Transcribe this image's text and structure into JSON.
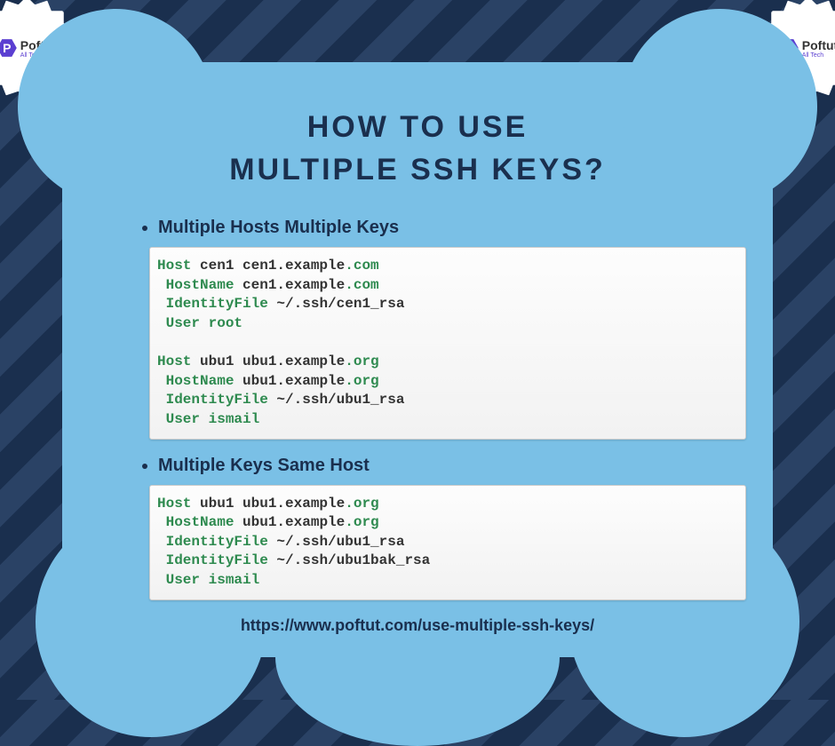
{
  "badge": {
    "title": "Poftut",
    "subtitle": "All Tech",
    "glyph": "P"
  },
  "title_line1": "HOW TO USE",
  "title_line2": "MULTIPLE SSH KEYS?",
  "section1_title": "Multiple Hosts Multiple Keys",
  "section2_title": "Multiple Keys Same Host",
  "footer_url": "https://www.poftut.com/use-multiple-ssh-keys/",
  "code1": {
    "l1_kw": "Host",
    "l1_rest": " cen1 cen1.example",
    "l1_dom": ".com",
    "l2_kw": " HostName",
    "l2_rest": " cen1.example",
    "l2_dom": ".com",
    "l3_kw": " IdentityFile",
    "l3_rest": " ~/.ssh/cen1_rsa",
    "l4_kw": " User",
    "l4_rest": " root",
    "l5": " ",
    "l6_kw": "Host",
    "l6_rest": " ubu1 ubu1.example",
    "l6_dom": ".org",
    "l7_kw": " HostName",
    "l7_rest": " ubu1.example",
    "l7_dom": ".org",
    "l8_kw": " IdentityFile",
    "l8_rest": " ~/.ssh/ubu1_rsa",
    "l9_kw": " User",
    "l9_rest": " ismail"
  },
  "code2": {
    "l1_kw": "Host",
    "l1_rest": " ubu1 ubu1.example",
    "l1_dom": ".org",
    "l2_kw": " HostName",
    "l2_rest": " ubu1.example",
    "l2_dom": ".org",
    "l3_kw": " IdentityFile",
    "l3_rest": " ~/.ssh/ubu1_rsa",
    "l4_kw": " IdentityFile",
    "l4_rest": " ~/.ssh/ubu1bak_rsa",
    "l5_kw": " User",
    "l5_rest": " ismail"
  }
}
